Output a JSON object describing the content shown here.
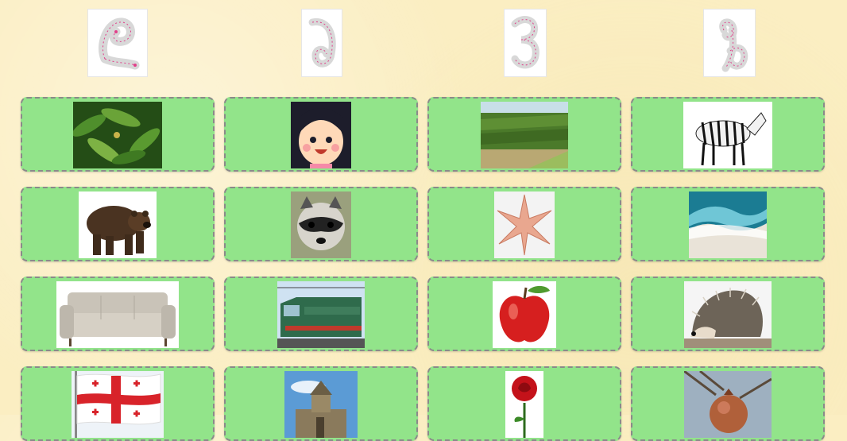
{
  "letters": [
    {
      "glyph": "ღ",
      "icon": "letter-trace-ghani-icon"
    },
    {
      "glyph": "ౌ",
      "icon": "letter-trace-icon"
    },
    {
      "glyph": "З",
      "icon": "letter-trace-icon"
    },
    {
      "glyph": "ზ",
      "icon": "letter-trace-zeni-icon"
    }
  ],
  "tiles": [
    {
      "image": "laurel-leaves-image"
    },
    {
      "image": "cartoon-girl-image"
    },
    {
      "image": "vineyard-image"
    },
    {
      "image": "zebra-image"
    },
    {
      "image": "brown-bear-image"
    },
    {
      "image": "raccoon-image"
    },
    {
      "image": "copper-star-image"
    },
    {
      "image": "sea-wave-image"
    },
    {
      "image": "sofa-image"
    },
    {
      "image": "electric-train-image"
    },
    {
      "image": "red-apple-image"
    },
    {
      "image": "hedgehog-image"
    },
    {
      "image": "georgian-flag-image"
    },
    {
      "image": "church-image"
    },
    {
      "image": "red-rose-image"
    },
    {
      "image": "pomegranate-image"
    }
  ]
}
